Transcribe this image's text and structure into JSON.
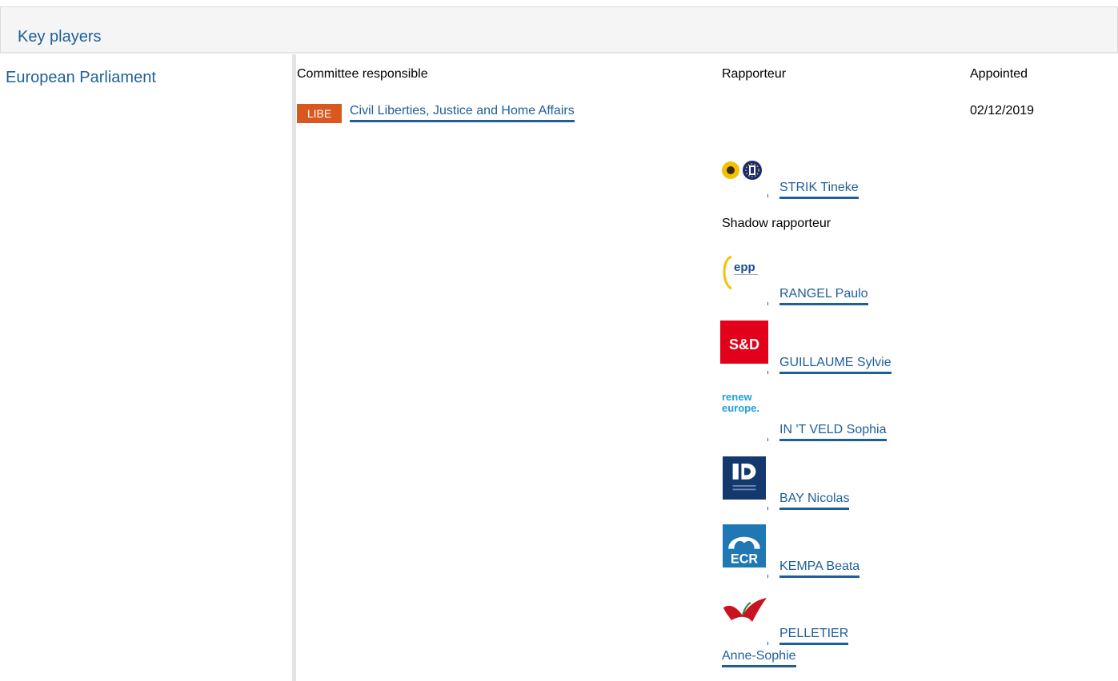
{
  "header": {
    "title": "Key players"
  },
  "institution": {
    "name": "European Parliament"
  },
  "columns": {
    "committee": "Committee responsible",
    "rapporteur": "Rapporteur",
    "appointed": "Appointed"
  },
  "committee": {
    "code": "LIBE",
    "name": "Civil Liberties, Justice and Home Affairs",
    "appointed": "02/12/2019",
    "badge_color": "#d9581f"
  },
  "rapporteur": {
    "name": "STRIK Tineke",
    "group_logo": "greens-efa-icon"
  },
  "shadow_label": "Shadow rapporteur",
  "shadows": [
    {
      "name": "RANGEL Paulo",
      "group_logo": "epp-icon"
    },
    {
      "name": "GUILLAUME Sylvie",
      "group_logo": "sd-icon"
    },
    {
      "name": "IN 'T VELD Sophia",
      "group_logo": "renew-europe-icon"
    },
    {
      "name": "BAY Nicolas",
      "group_logo": "id-icon"
    },
    {
      "name": "KEMPA Beata",
      "group_logo": "ecr-icon"
    },
    {
      "name_line1": "PELLETIER",
      "name_line2": "Anne-Sophie",
      "group_logo": "gue-ngl-icon"
    }
  ],
  "logos": {
    "sd_text": "S&D",
    "ecr_text": "ECR",
    "epp_text": "epp",
    "renew_text1": "renew",
    "renew_text2": "europe."
  },
  "colors": {
    "link": "#1f5f99",
    "header_bg": "#f5f5f5"
  }
}
